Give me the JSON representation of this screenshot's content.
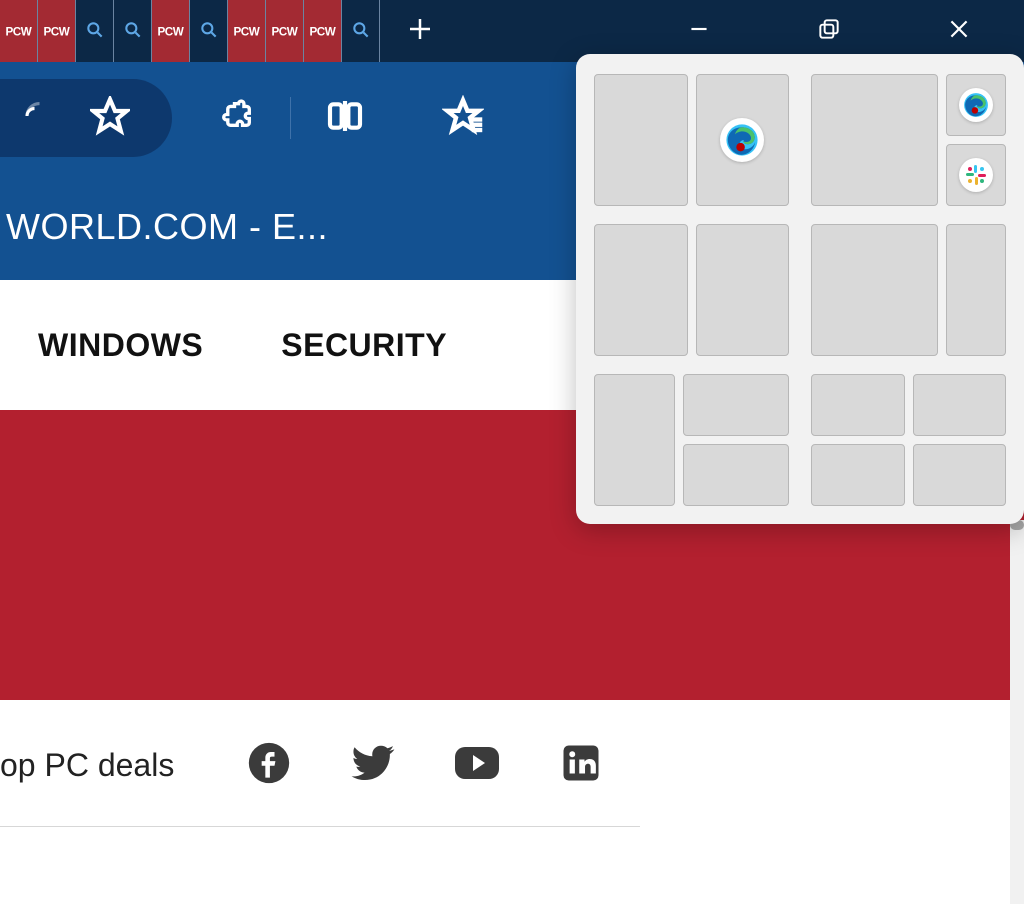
{
  "titlebar": {
    "tabs": [
      {
        "type": "pcw",
        "label": "PCW"
      },
      {
        "type": "pcw",
        "label": "PCW"
      },
      {
        "type": "search",
        "label": ""
      },
      {
        "type": "search",
        "label": ""
      },
      {
        "type": "pcw",
        "label": "PCW"
      },
      {
        "type": "search",
        "label": ""
      },
      {
        "type": "pcw",
        "label": "PCW"
      },
      {
        "type": "pcw",
        "label": "PCW"
      },
      {
        "type": "pcw",
        "label": "PCW"
      },
      {
        "type": "search",
        "label": ""
      }
    ]
  },
  "page": {
    "title": "WORLD.COM - E..."
  },
  "nav": {
    "items": [
      "WINDOWS",
      "SECURITY"
    ]
  },
  "footer": {
    "deals_text": "op PC deals"
  },
  "snap_layouts": {
    "apps": {
      "edge": "edge-icon",
      "slack": "slack-icon"
    }
  }
}
